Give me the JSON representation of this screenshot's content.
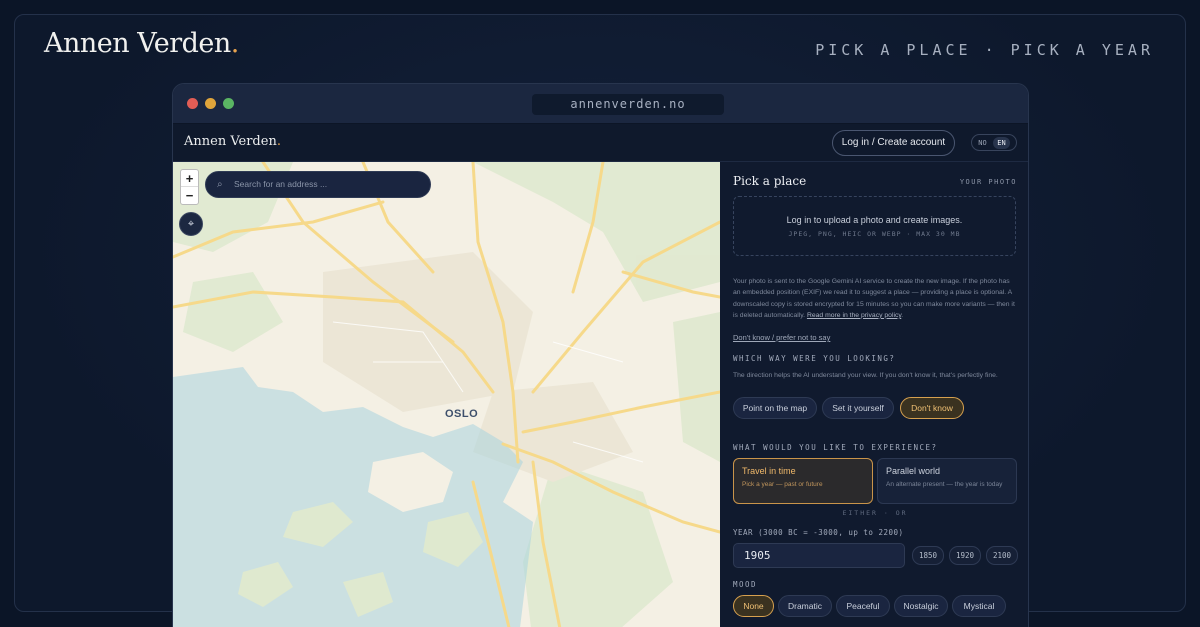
{
  "brand": {
    "name": "Annen Verden",
    "dot": "."
  },
  "tagline": "PICK A PLACE · PICK A YEAR",
  "browser": {
    "url": "annenverden.no"
  },
  "app": {
    "brand": "Annen Verden",
    "login_label": "Log in / Create account",
    "lang": {
      "no": "NO",
      "en": "EN",
      "selected": "EN"
    }
  },
  "map": {
    "search_placeholder": "Search for an address ...",
    "zoom_in": "+",
    "zoom_out": "−",
    "city_label": "OSLO"
  },
  "panel": {
    "title": "Pick a place",
    "your_photo": "YOUR PHOTO",
    "upload_title": "Log in to upload a photo and create images.",
    "upload_formats": "JPEG, PNG, HEIC OR WEBP · MAX 30 MB",
    "notice": "Your photo is sent to the Google Gemini AI service to create the new image. If the photo has an embedded position (EXIF) we read it to suggest a place — providing a place is optional. A downscaled copy is stored encrypted for 15 minutes so you can make more variants — then it is deleted automatically.",
    "notice_link": "Read more in the privacy policy",
    "dont_know_link": "Don't know / prefer not to say",
    "direction": {
      "heading": "WHICH WAY WERE YOU LOOKING?",
      "hint": "The direction helps the AI understand your view. If you don't know it, that's perfectly fine.",
      "options": [
        "Point on the map",
        "Set it yourself",
        "Don't know"
      ],
      "selected": "Don't know"
    },
    "experience": {
      "heading": "WHAT WOULD YOU LIKE TO EXPERIENCE?",
      "cards": [
        {
          "title": "Travel in time",
          "subtitle": "Pick a year — past or future"
        },
        {
          "title": "Parallel world",
          "subtitle": "An alternate present — the year is today"
        }
      ],
      "selected": "Travel in time",
      "divider": "EITHER · OR"
    },
    "year": {
      "heading": "YEAR (3000 BC = -3000, up to 2200)",
      "value": "1905",
      "presets": [
        "1850",
        "1920",
        "2100"
      ]
    },
    "mood": {
      "heading": "MOOD",
      "options": [
        "None",
        "Dramatic",
        "Peaceful",
        "Nostalgic",
        "Mystical"
      ],
      "selected": "None"
    }
  },
  "colors": {
    "accent": "#e8a34e",
    "background": "#0b1527",
    "panel": "#101a2e"
  }
}
